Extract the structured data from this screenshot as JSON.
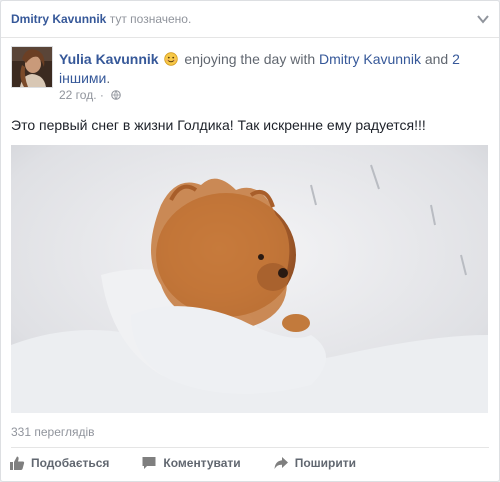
{
  "tagline": {
    "name": "Dmitry Kavunnik",
    "suffix": "тут позначено."
  },
  "post": {
    "author": "Yulia Kavunnik",
    "activity": "enjoying the day with",
    "tagged_name": "Dmitry Kavunnik",
    "and_text": "and",
    "others_link": "2 іншими",
    "period": ".",
    "time": "22 год.",
    "time_separator": "·",
    "text": "Это первый снег в жизни Голдика! Так искренне ему радуется!!!",
    "emoji": "smiling-face-icon",
    "privacy_icon": "globe-icon"
  },
  "video": {
    "views": "331 переглядів"
  },
  "actions": [
    {
      "label": "Подобається",
      "icon": "thumbs-up-icon"
    },
    {
      "label": "Коментувати",
      "icon": "comment-icon"
    },
    {
      "label": "Поширити",
      "icon": "share-icon"
    }
  ],
  "colors": {
    "link": "#365899",
    "meta": "#90949c",
    "background": "#e9ebee"
  }
}
